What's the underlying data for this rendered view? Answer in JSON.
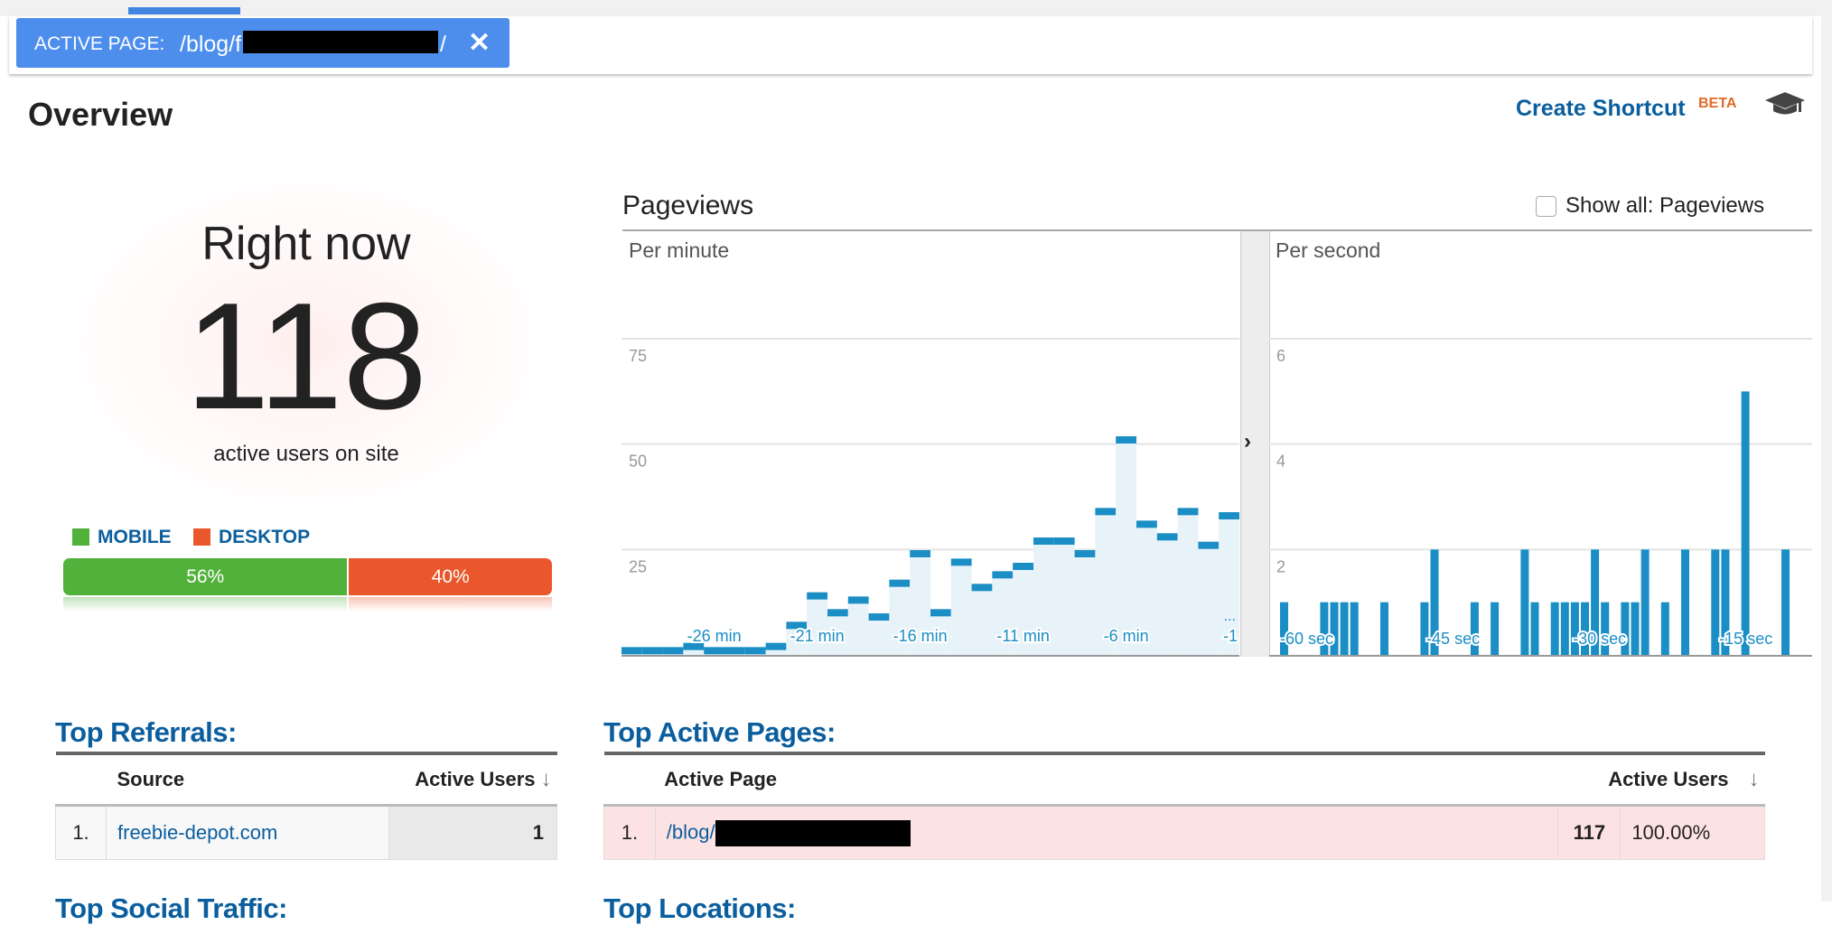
{
  "filter": {
    "label": "ACTIVE PAGE:",
    "value_prefix": "/blog/f",
    "value_suffix": "/",
    "close_icon": "close-icon",
    "color": "#4d8eed"
  },
  "header": {
    "title": "Overview",
    "shortcut_label": "Create Shortcut",
    "beta_label": "BETA",
    "help_icon": "graduation-cap-icon"
  },
  "rightnow": {
    "title": "Right now",
    "count": "118",
    "subtitle": "active users on site"
  },
  "devices": {
    "legend": [
      {
        "label": "MOBILE",
        "color": "#52b13b"
      },
      {
        "label": "DESKTOP",
        "color": "#ea572c"
      }
    ],
    "bar": [
      {
        "label": "56%",
        "percent": 56,
        "color": "#52b13b"
      },
      {
        "label": "40%",
        "percent": 40,
        "color": "#ea572c"
      }
    ]
  },
  "pageviews": {
    "title": "Pageviews",
    "show_all_label": "Show all: Pageviews",
    "show_all_checked": false
  },
  "chart_data": [
    {
      "type": "bar",
      "title": "Per minute",
      "x": [
        -30,
        -29,
        -28,
        -27,
        -26,
        -25,
        -24,
        -23,
        -22,
        -21,
        -20,
        -19,
        -18,
        -17,
        -16,
        -15,
        -14,
        -13,
        -12,
        -11,
        -10,
        -9,
        -8,
        -7,
        -6,
        -5,
        -4,
        -3,
        -2,
        -1
      ],
      "values": [
        1,
        1,
        1,
        2,
        1,
        1,
        1,
        2,
        7,
        14,
        10,
        13,
        9,
        17,
        24,
        10,
        22,
        16,
        19,
        21,
        27,
        27,
        24,
        34,
        51,
        31,
        28,
        34,
        26,
        33
      ],
      "xtick_labels": [
        "-26 min",
        "-21 min",
        "-16 min",
        "-11 min",
        "-6 min",
        "-1"
      ],
      "xticks": [
        -26,
        -21,
        -16,
        -11,
        -6,
        -1
      ],
      "ytick_labels": [
        "25",
        "50",
        "75"
      ],
      "ylim": [
        0,
        75
      ],
      "grid": true,
      "overflow_label": "...",
      "color": "#1a8ec5",
      "fill_color": "#e8f2f9"
    },
    {
      "type": "bar",
      "title": "Per second",
      "values": [
        1,
        0,
        0,
        0,
        1,
        1,
        1,
        1,
        0,
        0,
        1,
        0,
        0,
        0,
        1,
        2,
        0,
        0,
        0,
        1,
        0,
        1,
        0,
        0,
        2,
        1,
        0,
        1,
        1,
        1,
        1,
        2,
        1,
        0,
        1,
        1,
        2,
        0,
        1,
        0,
        2,
        0,
        0,
        2,
        2,
        0,
        5,
        0,
        0,
        0,
        2,
        0,
        0,
        0
      ],
      "xtick_labels": [
        "-60 sec",
        "-45 sec",
        "-30 sec",
        "-15 sec"
      ],
      "ytick_labels": [
        "2",
        "4",
        "6"
      ],
      "ylim": [
        0,
        6
      ],
      "grid": true,
      "color": "#1a8ec5"
    }
  ],
  "referrals": {
    "title": "Top Referrals:",
    "columns": [
      "Source",
      "Active Users"
    ],
    "rows": [
      {
        "rank": "1.",
        "source": "freebie-depot.com",
        "users": "1"
      }
    ]
  },
  "active_pages": {
    "title": "Top Active Pages:",
    "columns": [
      "Active Page",
      "Active Users"
    ],
    "rows": [
      {
        "rank": "1.",
        "page_prefix": "/blog/",
        "users": "117",
        "percent": "100.00%"
      }
    ]
  },
  "social": {
    "title": "Top Social Traffic:"
  },
  "locations": {
    "title": "Top Locations:"
  }
}
